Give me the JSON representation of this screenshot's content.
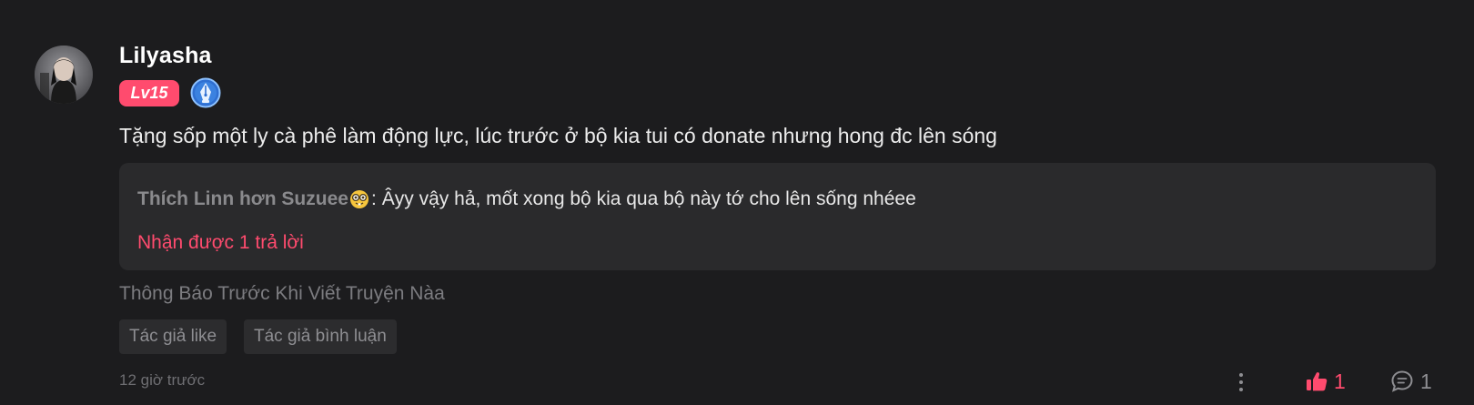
{
  "user": {
    "name": "Lilyasha",
    "level": "Lv15",
    "avatar_icon": "user-avatar"
  },
  "comment": {
    "text": "Tặng sốp một ly cà phê làm động lực, lúc trước ở bộ kia tui có donate nhưng hong đc lên sóng"
  },
  "reply_preview": {
    "author": "Thích Linn hơn Suzuee",
    "author_emoji": "nerd-face-emoji",
    "colon": ":",
    "text": "Âyy vậy hả, mốt xong bộ kia qua bộ này tớ cho lên sống nhéee",
    "reply_count_label": "Nhận được 1 trả lời"
  },
  "chapter": "Thông Báo Trước Khi Viết Truyện Nàa",
  "tags": [
    "Tác giả like",
    "Tác giả bình luận"
  ],
  "timestamp": "12 giờ trước",
  "actions": {
    "likes": "1",
    "replies": "1"
  },
  "colors": {
    "accent": "#ff4b6e",
    "background": "#1c1c1e",
    "reply_box": "#2a2a2c",
    "badge_blue": "#3b82e0"
  }
}
